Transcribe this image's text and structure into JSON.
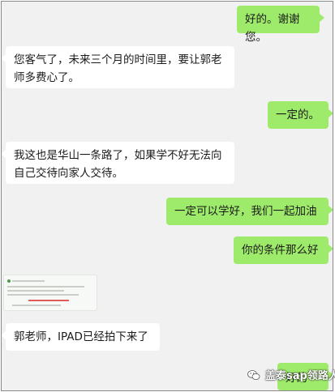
{
  "messages": [
    {
      "id": "m1",
      "side": "out",
      "text": "好的。谢谢您。"
    },
    {
      "id": "m2",
      "side": "in",
      "text": "您客气了，未来三个月的时间里，要让郭老师多费心了。"
    },
    {
      "id": "m3",
      "side": "out",
      "text": "一定的。"
    },
    {
      "id": "m4",
      "side": "in",
      "text": "我这也是华山一条路了，如果学不好无法向自己交待向家人交待。"
    },
    {
      "id": "m5",
      "side": "out",
      "text": "一定可以学好，我们一起加油"
    },
    {
      "id": "m6",
      "side": "out",
      "text": "你的条件那么好"
    },
    {
      "id": "m7",
      "side": "in",
      "type": "image-thumbnail"
    },
    {
      "id": "m8",
      "side": "in",
      "text": "郭老师，IPAD已经拍下来了"
    },
    {
      "id": "m9",
      "side": "out",
      "text": "好的"
    }
  ],
  "watermark": {
    "text": "盖泰sap领路人",
    "icon": "wechat-icon"
  },
  "colors": {
    "outgoing_bubble": "#9eea6a",
    "incoming_bubble": "#ffffff",
    "background": "#f1f1f1"
  }
}
